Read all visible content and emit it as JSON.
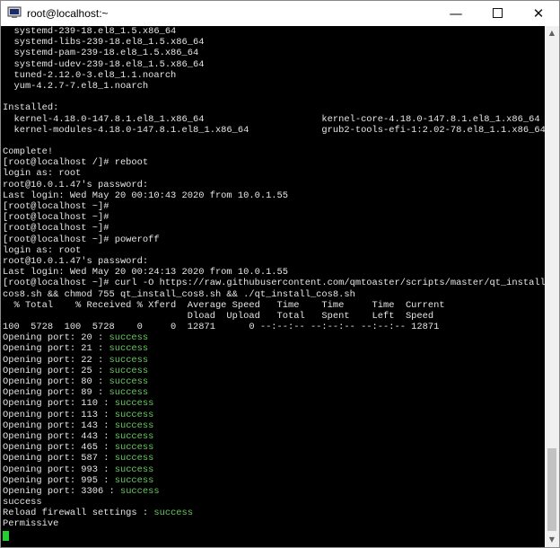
{
  "window": {
    "title": "root@localhost:~",
    "controls": {
      "minimize": "—",
      "close": "✕"
    }
  },
  "terminal": {
    "success_color": "#67c75e",
    "text_color": "#e6e6e6",
    "cursor_color": "#1fd02f",
    "lines": [
      {
        "text": "  systemd-239-18.el8_1.5.x86_64"
      },
      {
        "text": "  systemd-libs-239-18.el8_1.5.x86_64"
      },
      {
        "text": "  systemd-pam-239-18.el8_1.5.x86_64"
      },
      {
        "text": "  systemd-udev-239-18.el8_1.5.x86_64"
      },
      {
        "text": "  tuned-2.12.0-3.el8_1.1.noarch"
      },
      {
        "text": "  yum-4.2.7-7.el8_1.noarch"
      },
      {
        "text": ""
      },
      {
        "text": "Installed:"
      },
      {
        "text": "  kernel-4.18.0-147.8.1.el8_1.x86_64                     kernel-core-4.18.0-147.8.1.el8_1.x86_64"
      },
      {
        "text": "  kernel-modules-4.18.0-147.8.1.el8_1.x86_64             grub2-tools-efi-1:2.02-78.el8_1.1.x86_64"
      },
      {
        "text": ""
      },
      {
        "text": "Complete!"
      },
      {
        "text": "[root@localhost /]# reboot"
      },
      {
        "text": "login as: root"
      },
      {
        "text": "root@10.0.1.47's password:"
      },
      {
        "text": "Last login: Wed May 20 00:10:43 2020 from 10.0.1.55"
      },
      {
        "text": "[root@localhost ~]#"
      },
      {
        "text": "[root@localhost ~]#"
      },
      {
        "text": "[root@localhost ~]#"
      },
      {
        "text": "[root@localhost ~]# poweroff"
      },
      {
        "text": "login as: root"
      },
      {
        "text": "root@10.0.1.47's password:"
      },
      {
        "text": "Last login: Wed May 20 00:24:13 2020 from 10.0.1.55"
      },
      {
        "text": "[root@localhost ~]# curl -O https://raw.githubusercontent.com/qmtoaster/scripts/master/qt_install_"
      },
      {
        "text": "cos8.sh && chmod 755 qt_install_cos8.sh && ./qt_install_cos8.sh"
      },
      {
        "text": "  % Total    % Received % Xferd  Average Speed   Time    Time     Time  Current"
      },
      {
        "text": "                                 Dload  Upload   Total   Spent    Left  Speed"
      },
      {
        "text": "100  5728  100  5728    0     0  12871      0 --:--:-- --:--:-- --:--:-- 12871"
      },
      {
        "text": "Opening port: 20 : ",
        "status": "success"
      },
      {
        "text": "Opening port: 21 : ",
        "status": "success"
      },
      {
        "text": "Opening port: 22 : ",
        "status": "success"
      },
      {
        "text": "Opening port: 25 : ",
        "status": "success"
      },
      {
        "text": "Opening port: 80 : ",
        "status": "success"
      },
      {
        "text": "Opening port: 89 : ",
        "status": "success"
      },
      {
        "text": "Opening port: 110 : ",
        "status": "success"
      },
      {
        "text": "Opening port: 113 : ",
        "status": "success"
      },
      {
        "text": "Opening port: 143 : ",
        "status": "success"
      },
      {
        "text": "Opening port: 443 : ",
        "status": "success"
      },
      {
        "text": "Opening port: 465 : ",
        "status": "success"
      },
      {
        "text": "Opening port: 587 : ",
        "status": "success"
      },
      {
        "text": "Opening port: 993 : ",
        "status": "success"
      },
      {
        "text": "Opening port: 995 : ",
        "status": "success"
      },
      {
        "text": "Opening port: 3306 : ",
        "status": "success"
      },
      {
        "text": "success"
      },
      {
        "text": "Reload firewall settings : ",
        "status": "success"
      },
      {
        "text": "Permissive"
      }
    ]
  }
}
